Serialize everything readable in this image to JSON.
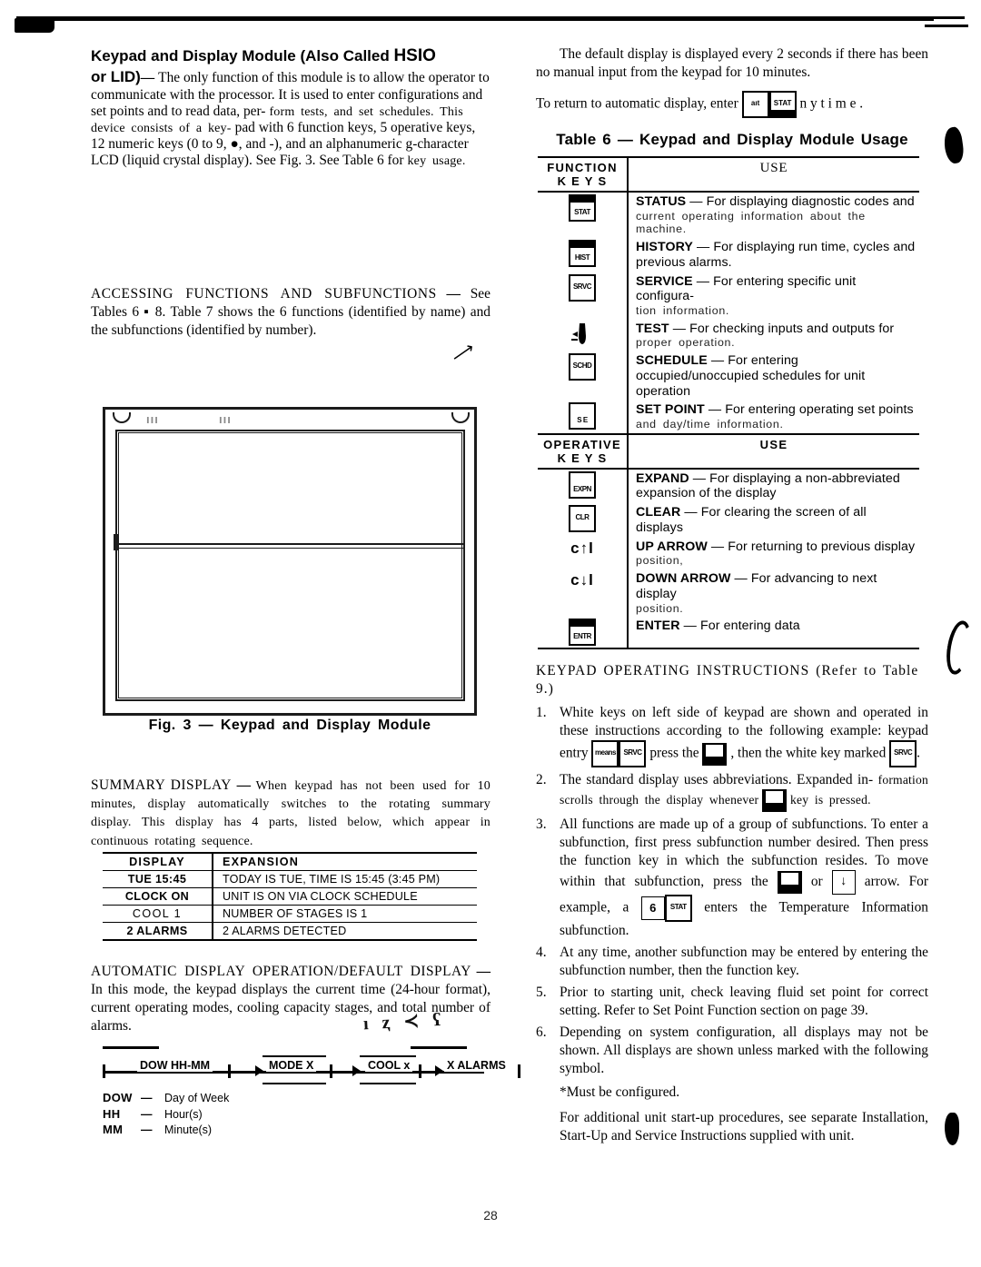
{
  "page": {
    "number": "28"
  },
  "left_column": {
    "heading": "Keypad and Display Module (Also Called HSIO or LID)",
    "heading_part1": "Keypad and Display Module (Also Called ",
    "heading_hsio": "HSIO",
    "heading_part2": "or LID)",
    "intro_dash": "—",
    "intro_body": "The only function of this module is to allow the operator to communicate with the processor. It is used to enter configurations and set points and to read data, per-",
    "intro_body2": "form tests, and set schedules. This device consists of a key-",
    "intro_body3": "pad with 6 function keys, 5 operative keys, 12 numeric keys (0 to 9, ●, and -), and an alphanumeric g-character LCD (liquid crystal display). See Fig. 3. See Table 6 for",
    "intro_body4": "key usage.",
    "accessing_heading": "ACCESSING FUNCTIONS AND SUBFUNCTIONS",
    "accessing_body": "See Tables 6 ▪ 8. Table 7 shows the 6 functions (identified by name) and the subfunctions (identified by number).",
    "figure": {
      "caption": "Fig. 3 — Keypad and Display Module",
      "smudge_left": "ııı",
      "smudge_right": "ııı"
    },
    "summary_heading": "SUMMARY DISPLAY",
    "summary_body": "When keypad has not been used for 10 minutes, display automatically switches to the rotating summary display. This display has 4 parts, listed below, which appear in continuous rotating sequence.",
    "summary_table": {
      "headers": [
        "DISPLAY",
        "EXPANSION"
      ],
      "rows": [
        {
          "display": "TUE 15:45",
          "expansion": "TODAY IS TUE, TIME IS 15:45 (3:45 PM)",
          "light": false
        },
        {
          "display": "CLOCK ON",
          "expansion": "UNIT IS ON VIA CLOCK SCHEDULE",
          "light": false
        },
        {
          "display": "COOL 1",
          "expansion": "NUMBER OF STAGES IS 1",
          "light": true
        },
        {
          "display": "2 ALARMS",
          "expansion": "2 ALARMS DETECTED",
          "light": false
        }
      ]
    },
    "auto_heading": "AUTOMATIC DISPLAY OPERATION/DEFAULT DISPLAY",
    "auto_body": "In this mode, the keypad displays the current time (24-hour format), current operating modes, cooling capacity stages, and total number of alarms.",
    "scribble": "ı ⱬ ≺ ʕ",
    "flow": {
      "boxes": [
        "DOW HH-MM",
        "MODE X",
        "COOL x",
        "X ALARMS"
      ]
    },
    "legend": [
      {
        "abbr": "DOW",
        "dash": "—",
        "meaning": "Day of Week"
      },
      {
        "abbr": "HH",
        "dash": "—",
        "meaning": "Hour(s)"
      },
      {
        "abbr": "MM",
        "dash": "—",
        "meaning": "Minute(s)"
      }
    ]
  },
  "right_column": {
    "para1": "The default display is displayed every 2 seconds if there has been no manual input from the keypad for 10 minutes.",
    "para2_pre": "To return to automatic display, enter",
    "para2_key1": "aıt",
    "para2_key2": "STAT",
    "para2_post": "n y    t i m e .",
    "table_title": "Table 6 — Keypad and Display Module Usage",
    "table": {
      "section1_header": {
        "keys": "FUNCTION KEYS",
        "keys_line1": "FUNCTION",
        "keys_line2": "K E Y S",
        "use": "USE"
      },
      "function_keys": [
        {
          "key": "STAT",
          "key_glyph": "stat-key",
          "title": "STATUS",
          "dash": "—",
          "main": "For displaying diagnostic codes and",
          "sub": "current operating information about the machine."
        },
        {
          "key": "HIST",
          "key_glyph": "hist-key",
          "title": "HISTORY",
          "dash": "—",
          "main": "For displaying run time, cycles and previous alarms.",
          "sub": ""
        },
        {
          "key": "SRVC",
          "key_glyph": "srvc-key",
          "title": "SERVICE",
          "dash": "—",
          "main": "For entering specific unit configura-",
          "sub": "tion information."
        },
        {
          "key": "TEST",
          "key_glyph": "test-key",
          "title": "TEST",
          "dash": "—",
          "main": "For checking inputs and outputs for",
          "sub": "proper operation."
        },
        {
          "key": "SCHD",
          "key_glyph": "schd-key",
          "title": "SCHEDULE",
          "dash": "—",
          "main": "For entering occupied/unoccupied schedules for unit operation",
          "sub": ""
        },
        {
          "key": "S E",
          "key_glyph": "setpoint-key",
          "title": "SET POINT",
          "dash": "—",
          "main": "For entering operating set points",
          "sub": "and day/time information."
        }
      ],
      "section2_header": {
        "keys_line1": "OPERATIVE",
        "keys_line2": "K E Y S",
        "use": "USE"
      },
      "operative_keys": [
        {
          "key": "EXPN",
          "key_glyph": "expand-key",
          "title": "EXPAND",
          "dash": "—",
          "main": "For displaying a non-abbreviated expansion of the display",
          "sub": ""
        },
        {
          "key": "CLR",
          "key_glyph": "clear-key",
          "title": "CLEAR",
          "dash": "—",
          "main": "For clearing the screen of all displays",
          "sub": ""
        },
        {
          "key": "c↑l",
          "key_glyph": "up-arrow-key",
          "title": "UP ARROW",
          "dash": "—",
          "main": "For returning to previous display",
          "sub": "position,"
        },
        {
          "key": "c↓l",
          "key_glyph": "down-arrow-key",
          "title": "DOWN ARROW",
          "dash": "—",
          "main": "For advancing to next display",
          "sub": "position."
        },
        {
          "key": "ENTR",
          "key_glyph": "enter-key",
          "title": "ENTER",
          "dash": "—",
          "main": "For entering data",
          "sub": ""
        }
      ]
    },
    "instructions_heading": "KEYPAD OPERATING INSTRUCTIONS (Refer to Table 9.)",
    "steps": [
      {
        "num": "1.",
        "text_a": "White keys on left side of keypad are shown and operated in these instructions according to the following example: keypad entry",
        "key_inline1": "means",
        "key_inline2": "SRVC",
        "text_b": "press  the",
        "text_c": ", then the white key marked",
        "key_inline3": "SRVC",
        "text_d": "."
      },
      {
        "num": "2.",
        "text_a": "The standard display uses abbreviations. Expanded in-",
        "text_b": "formation scrolls through the display whenever",
        "text_c": "key is pressed."
      },
      {
        "num": "3.",
        "text_a": "All functions are made up of a group of subfunctions. To enter a subfunction, first press subfunction number desired. Then press the function key in which the subfunction resides. To move within that subfunction, press",
        "text_the": "the",
        "text_or": "or",
        "text_b": "arrow. For example, a",
        "key_6": "6",
        "key_stat": "STAT",
        "text_c": "enters the Temperature Information subfunction."
      },
      {
        "num": "4.",
        "text_a": "At any time, another subfunction may be entered by entering the subfunction number, then the function key."
      },
      {
        "num": "5.",
        "text_a": "Prior to starting unit, check leaving fluid set point for correct setting. Refer to Set Point Function section on page 39."
      },
      {
        "num": "6.",
        "text_a": "Depending on system configuration, all displays may not be shown. All displays are shown unless marked with the following symbol.",
        "note": "*Must be configured.",
        "footer": "For additional unit start-up procedures, see separate Installation, Start-Up and Service Instructions supplied with unit."
      }
    ]
  }
}
